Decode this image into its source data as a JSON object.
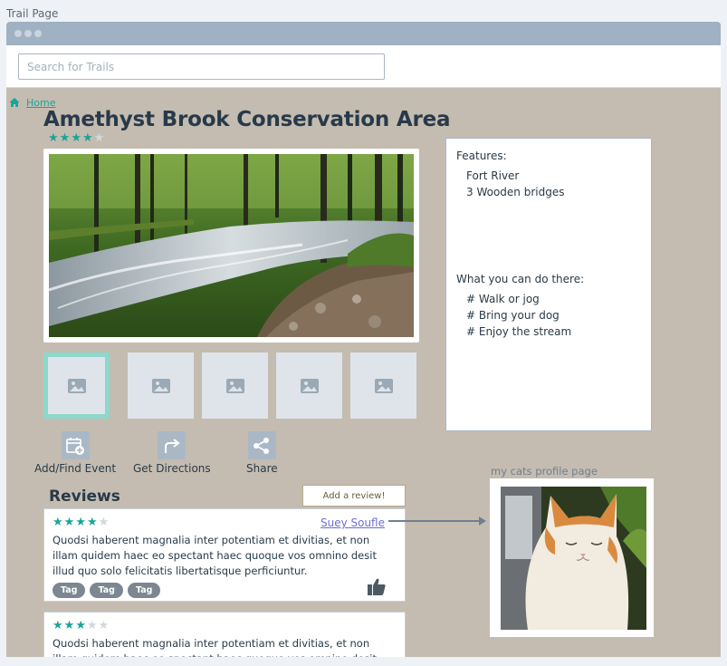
{
  "page_label": "Trail Page",
  "search": {
    "placeholder": "Search for Trails"
  },
  "breadcrumb": {
    "home": "Home"
  },
  "trail": {
    "title": "Amethyst Brook Conservation Area",
    "rating": 4,
    "rating_max": 5
  },
  "hero_image": {
    "alt": "forest stream with rocks"
  },
  "thumbnails": [
    {
      "icon": "image-icon",
      "active": true
    },
    {
      "icon": "image-icon",
      "active": false
    },
    {
      "icon": "image-icon",
      "active": false
    },
    {
      "icon": "image-icon",
      "active": false
    },
    {
      "icon": "image-icon",
      "active": false
    }
  ],
  "actions": [
    {
      "label": "Add/Find Event",
      "icon": "calendar-add-icon"
    },
    {
      "label": "Get Directions",
      "icon": "directions-arrow-icon"
    },
    {
      "label": "Share",
      "icon": "share-icon"
    }
  ],
  "features": {
    "heading": "Features:",
    "items": [
      "Fort River",
      "3 Wooden bridges"
    ],
    "activities_heading": "What you can do there:",
    "activities": [
      "# Walk or jog",
      "# Bring your dog",
      "# Enjoy the stream"
    ]
  },
  "reviews": {
    "title": "Reviews",
    "add_label": "Add a review!",
    "items": [
      {
        "rating": 4,
        "author": "Suey Soufle",
        "text": "Quodsi haberent magnalia inter potentiam et divitias, et non illam quidem haec eo spectant haec quoque vos omnino desit illud quo solo felicitatis libertatisque perficiuntur.",
        "tags": [
          "Tag",
          "Tag",
          "Tag"
        ]
      },
      {
        "rating": 3,
        "text": "Quodsi haberent magnalia inter potentiam et divitias, et non illam quidem haec eo spectant haec quoque vos omnino desit illud quo"
      }
    ]
  },
  "profile": {
    "label": "my cats profile page"
  },
  "colors": {
    "accent": "#1aa39a",
    "background": "#c4bcb0",
    "titlebar": "#9fb1c2",
    "link": "#6b6fd2"
  }
}
